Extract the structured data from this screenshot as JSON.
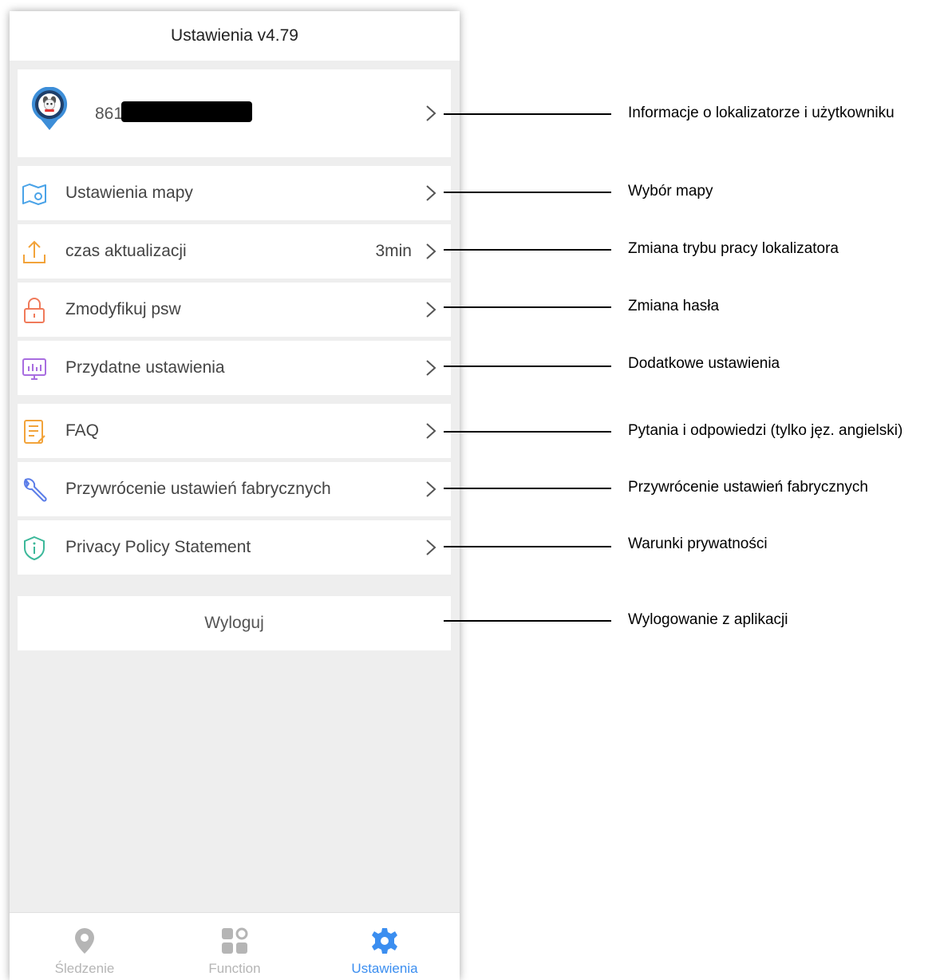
{
  "header": {
    "title": "Ustawienia v4.79"
  },
  "device": {
    "id_prefix": "861"
  },
  "menu": {
    "map_settings": "Ustawienia mapy",
    "update_time": "czas aktualizacji",
    "update_time_value": "3min",
    "modify_password": "Zmodyfikuj psw",
    "useful_settings": "Przydatne ustawienia",
    "faq": "FAQ",
    "factory_reset": "Przywrócenie ustawień fabrycznych",
    "privacy": "Privacy Policy Statement"
  },
  "logout": {
    "label": "Wyloguj"
  },
  "tabs": {
    "tracking": "Śledzenie",
    "function": "Function",
    "settings": "Ustawienia",
    "active_color": "#3b8ef0",
    "inactive_color": "#b5b5b5"
  },
  "annotations": {
    "device": "Informacje o lokalizatorze i użytkowniku",
    "map": "Wybór mapy",
    "update": "Zmiana trybu pracy lokalizatora",
    "password": "Zmiana hasła",
    "useful": "Dodatkowe ustawienia",
    "faq": "Pytania i odpowiedzi (tylko jęz. angielski)",
    "reset": "Przywrócenie ustawień fabrycznych",
    "privacy": "Warunki prywatności",
    "logout": "Wylogowanie z aplikacji"
  }
}
